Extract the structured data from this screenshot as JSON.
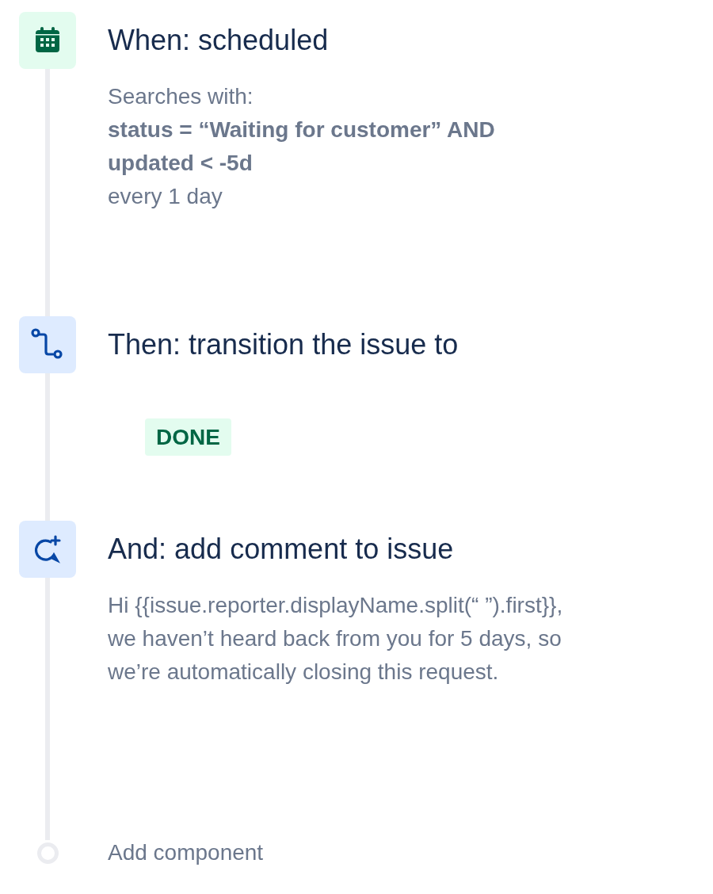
{
  "steps": [
    {
      "kind": "schedule",
      "title": "When: scheduled",
      "lines": [
        {
          "text": "Searches with:",
          "bold": false
        },
        {
          "text": "status = “Waiting for customer” AND updated < -5d",
          "bold": true
        },
        {
          "text": "every 1 day",
          "bold": false
        }
      ]
    },
    {
      "kind": "transition",
      "title": "Then: transition the issue to",
      "status": "DONE"
    },
    {
      "kind": "comment",
      "title": "And: add comment to issue",
      "lines": [
        {
          "text": "Hi {{issue.reporter.displayName.split(“ ”).first}}, we haven’t heard back from you for 5 days, so we’re automatically closing this request.",
          "bold": false
        }
      ]
    }
  ],
  "add_component": {
    "label": "Add component"
  }
}
